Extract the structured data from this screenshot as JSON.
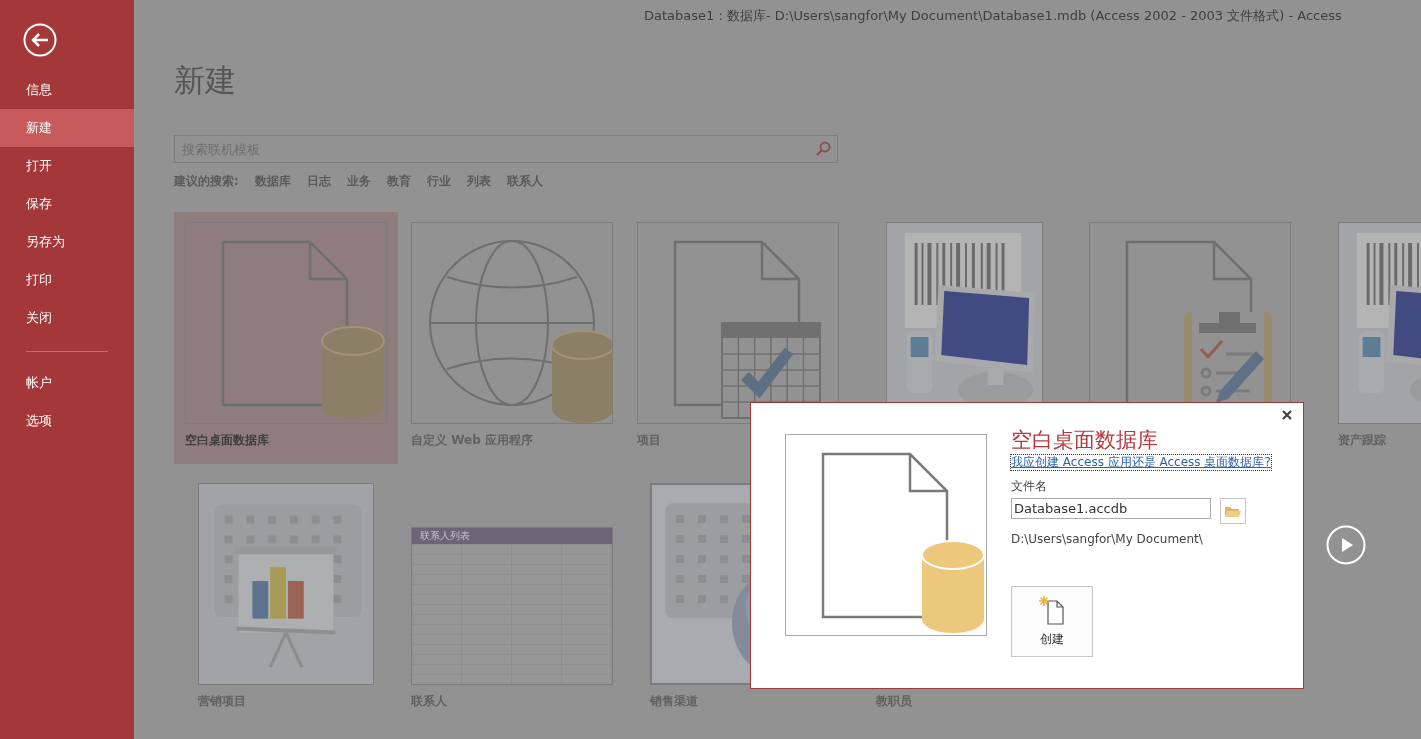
{
  "window": {
    "title": "Database1 : 数据库- D:\\Users\\sangfor\\My Document\\Database1.mdb (Access 2002 - 2003 文件格式) - Access"
  },
  "sidebar": {
    "items": [
      {
        "label": "信息",
        "selected": false
      },
      {
        "label": "新建",
        "selected": true
      },
      {
        "label": "打开",
        "selected": false
      },
      {
        "label": "保存",
        "selected": false
      },
      {
        "label": "另存为",
        "selected": false
      },
      {
        "label": "打印",
        "selected": false
      },
      {
        "label": "关闭",
        "selected": false
      }
    ],
    "footer_items": [
      {
        "label": "帐户",
        "selected": false
      },
      {
        "label": "选项",
        "selected": false
      }
    ]
  },
  "page": {
    "heading": "新建",
    "search": {
      "placeholder": "搜索联机模板"
    },
    "suggested": {
      "label": "建议的搜索:",
      "terms": [
        "数据库",
        "日志",
        "业务",
        "教育",
        "行业",
        "列表",
        "联系人"
      ]
    }
  },
  "template_rows": [
    {
      "items": [
        {
          "kind": "blank-database",
          "label": "空白桌面数据库",
          "selected": true
        },
        {
          "kind": "web-app",
          "label": "自定义 Web 应用程序",
          "selected": false
        },
        {
          "kind": "project",
          "label": "项目",
          "selected": false
        },
        {
          "kind": "asset",
          "selected": false
        },
        {
          "kind": "task",
          "selected": false
        },
        {
          "kind": "asset",
          "label": "资产跟踪",
          "selected": false
        }
      ]
    },
    {
      "items": [
        {
          "kind": "marketing",
          "label": "营销项目",
          "selected": false
        },
        {
          "kind": "contacts",
          "label": "联系人",
          "preview_title": "联系人列表",
          "selected": false
        },
        {
          "kind": "sales",
          "label": "销售渠道",
          "selected": false
        },
        {
          "label": "教职员",
          "selected": false
        }
      ]
    }
  ],
  "dialog": {
    "title": "空白桌面数据库",
    "help_link": "我应创建 Access 应用还是 Access 桌面数据库?",
    "file_name_label": "文件名",
    "file_name": "Database1.accdb",
    "folder": "D:\\Users\\sangfor\\My Document\\",
    "create_button": "创建"
  }
}
